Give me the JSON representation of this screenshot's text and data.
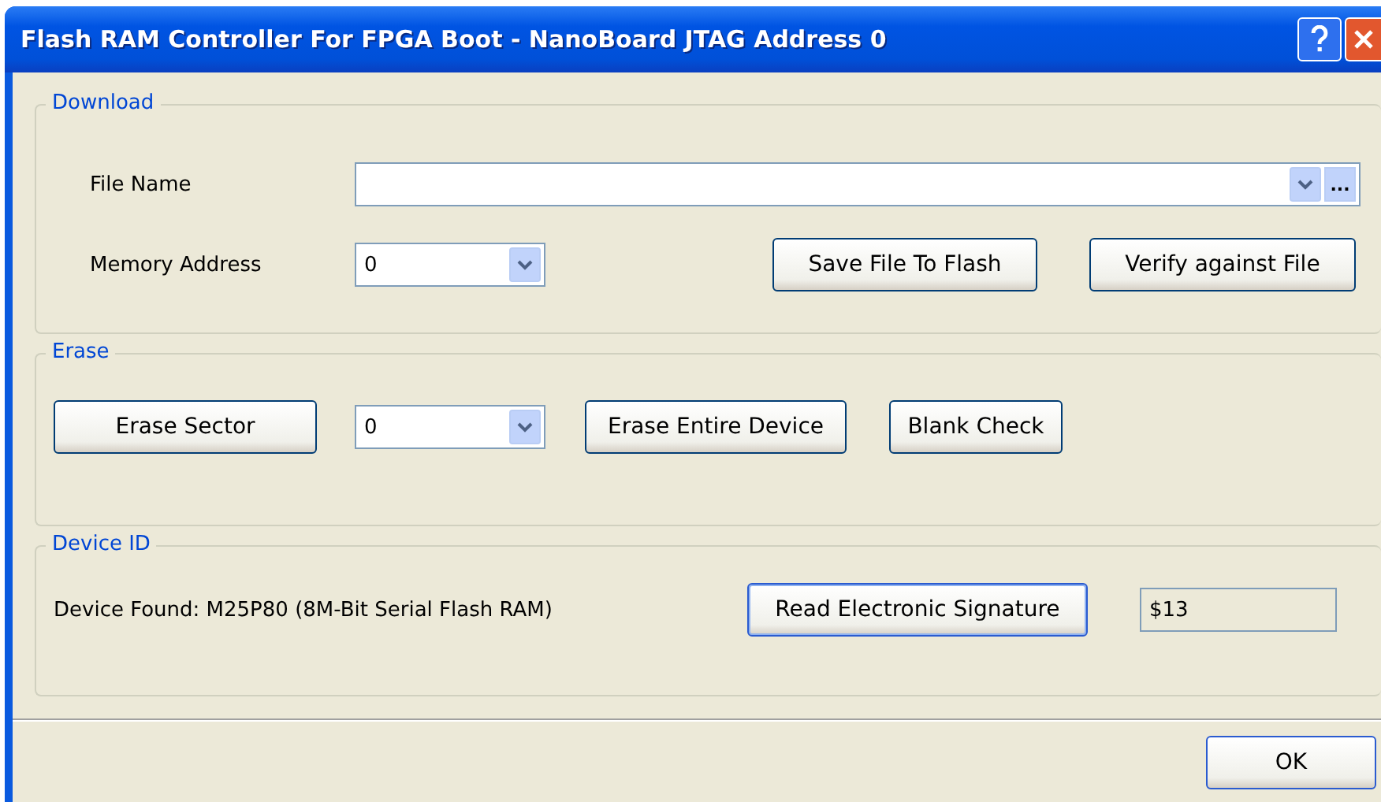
{
  "window": {
    "title": "Flash RAM Controller For FPGA Boot - NanoBoard JTAG Address 0"
  },
  "download": {
    "title": "Download",
    "file_name": {
      "label": "File Name",
      "browse": "..."
    },
    "memory_address": {
      "label": "Memory Address",
      "value": "0"
    },
    "buttons": [
      "Save File To Flash",
      "Verify against File"
    ]
  },
  "erase": {
    "title": "Erase",
    "erase_sector": "Erase Sector",
    "sector": "0",
    "buttons": [
      "Erase Entire Device",
      "Blank Check"
    ]
  },
  "device_id": {
    "title": "Device ID",
    "device_found": "Device Found: M25P80 (8M-Bit Serial Flash RAM)",
    "button": "Read Electronic Signature",
    "signature": {
      "value": "$13",
      "read_only": true
    }
  },
  "footer": {
    "ok": "OK"
  }
}
